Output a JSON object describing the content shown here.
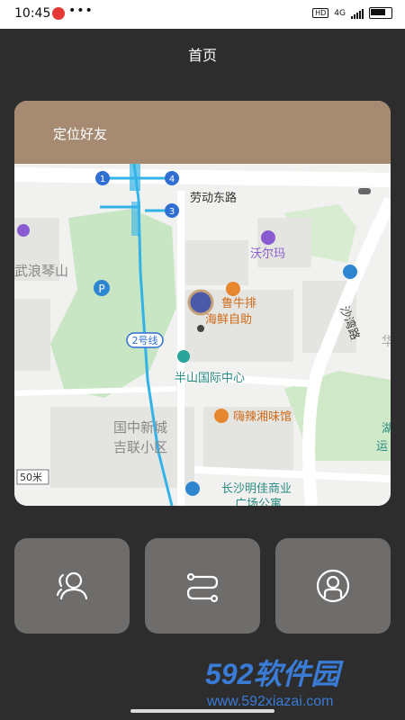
{
  "status_bar": {
    "time": "10:45",
    "dots": "•••",
    "hd": "HD",
    "network": "4G"
  },
  "page_title": "首页",
  "card": {
    "header_label": "定位好友",
    "map_labels": {
      "road_laodong": "劳动东路",
      "walmart": "沃尔玛",
      "wulang": "武浪琴山",
      "shawan_road": "沙湾路",
      "lu_niupai": "鲁牛排",
      "haixian": "海鲜自助",
      "line2": "2号线",
      "banshan": "半山国际中心",
      "hala": "嗨辣湘味馆",
      "guozhong": "国中新城",
      "jilian": "吉联小区",
      "scale": "50米",
      "mingjia": "长沙明佳商业",
      "mingjia2": "广场公寓",
      "station1": "1",
      "station3": "3",
      "station4": "4",
      "hu": "湖",
      "yun": "运",
      "hua": "华"
    }
  },
  "buttons": [
    {
      "icon": "friends-icon"
    },
    {
      "icon": "route-icon"
    },
    {
      "icon": "profile-icon"
    }
  ],
  "watermark": {
    "brand": "592软件园",
    "url": "www.592xiazai.com"
  },
  "colors": {
    "background": "#2d2d2d",
    "card_header": "#a68a72",
    "button": "#6e6d6b",
    "metro": "#34b3e8",
    "poi_orange": "#e7872d",
    "poi_purple": "#8a5bd0",
    "poi_teal": "#2aa39a"
  }
}
